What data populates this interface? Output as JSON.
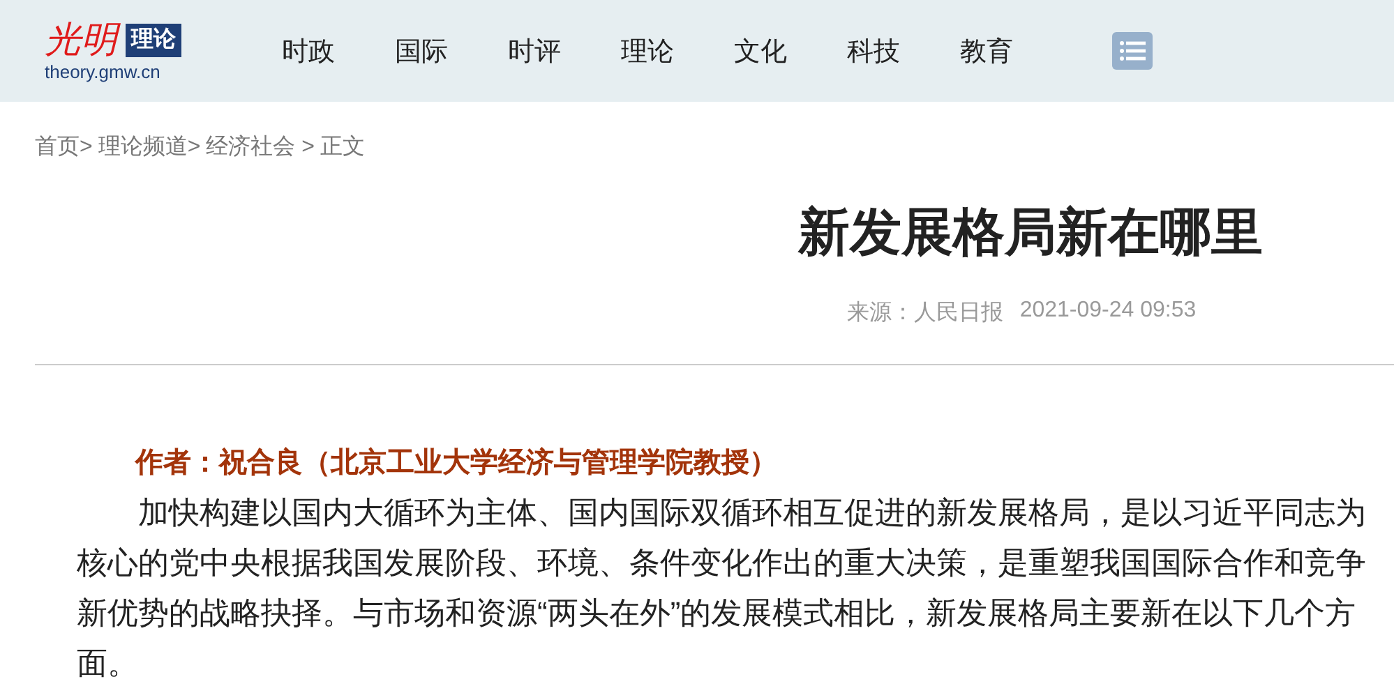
{
  "header": {
    "logo": {
      "mark": "光明",
      "badge": "理论",
      "domain": "theory.gmw.cn"
    },
    "nav": [
      {
        "label": "时政"
      },
      {
        "label": "国际"
      },
      {
        "label": "时评"
      },
      {
        "label": "理论"
      },
      {
        "label": "文化"
      },
      {
        "label": "科技"
      },
      {
        "label": "教育"
      }
    ]
  },
  "breadcrumb": [
    "首页>",
    "理论频道>",
    "经济社会 >",
    "正文"
  ],
  "article": {
    "title": "新发展格局新在哪里",
    "source": "来源：人民日报",
    "date": "2021-09-24 09:53",
    "author": "作者：祝合良（北京工业大学经济与管理学院教授）",
    "paragraphs": [
      "加快构建以国内大循环为主体、国内国际双循环相互促进的新发展格局，是以习近平同志为核心的党中央根据我国发展阶段、环境、条件变化作出的重大决策，是重塑我国国际合作和竞争新优势的战略抉择。与市场和资源“两头在外”的发展模式相比，新发展格局主要新在以下几个方面。"
    ]
  }
}
